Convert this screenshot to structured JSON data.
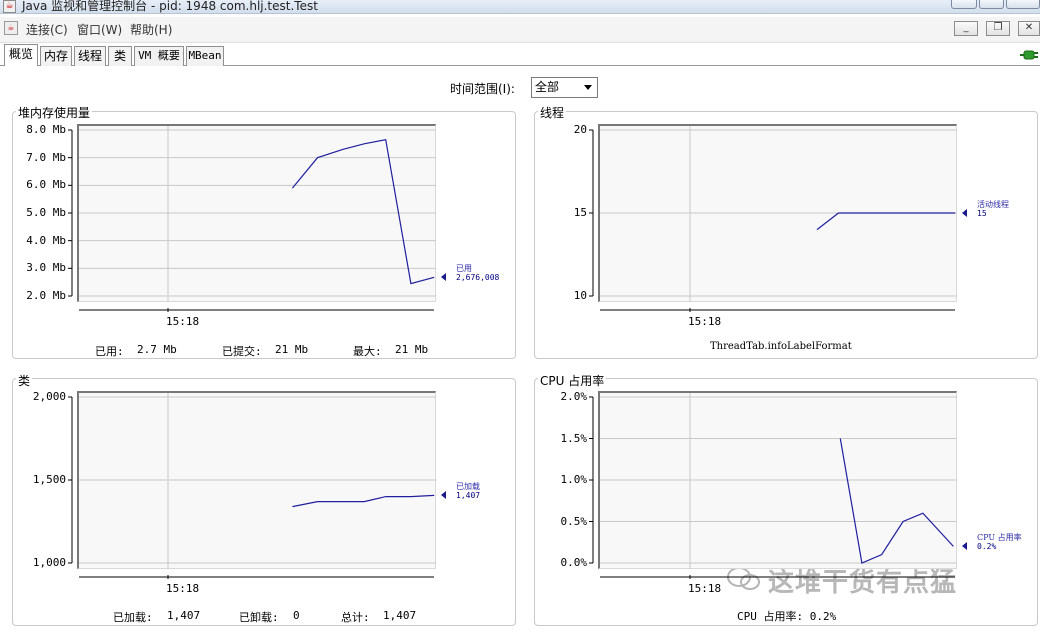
{
  "window": {
    "title": "Java 监视和管理控制台 - pid: 1948 com.hlj.test.Test",
    "app_icon": "java-cup-icon"
  },
  "menu": {
    "items": [
      "连接(C)",
      "窗口(W)",
      "帮助(H)"
    ]
  },
  "tabs": [
    "概览",
    "内存",
    "线程",
    "类",
    "VM 概要",
    "MBean"
  ],
  "active_tab": "概览",
  "time_range": {
    "label": "时间范围(I):",
    "value": "全部"
  },
  "colors": {
    "series_line": "#1f1fa0",
    "legend_text": "#2b2ba8",
    "grid": "#c8c8c8"
  },
  "panels": {
    "heap": {
      "title": "堆内存使用量",
      "y_ticks": [
        "8.0 Mb",
        "7.0 Mb",
        "6.0 Mb",
        "5.0 Mb",
        "4.0 Mb",
        "3.0 Mb",
        "2.0 Mb"
      ],
      "x_tick": "15:18",
      "legend_name": "已用",
      "legend_value": "2,676,008",
      "footer": {
        "used_label": "已用:",
        "used_value": "2.7  Mb",
        "committed_label": "已提交:",
        "committed_value": "21  Mb",
        "max_label": "最大:",
        "max_value": "21  Mb"
      }
    },
    "threads": {
      "title": "线程",
      "y_ticks": [
        "20",
        "15",
        "10"
      ],
      "x_tick": "15:18",
      "legend_name": "活动线程",
      "legend_value": "15",
      "footer": "ThreadTab.infoLabelFormat"
    },
    "classes": {
      "title": "类",
      "y_ticks": [
        "2,000",
        "1,500",
        "1,000"
      ],
      "x_tick": "15:18",
      "legend_name": "已加载",
      "legend_value": "1,407",
      "footer": {
        "loaded_label": "已加载:",
        "loaded_value": "1,407",
        "unloaded_label": "已卸载:",
        "unloaded_value": "0",
        "total_label": "总计:",
        "total_value": "1,407"
      }
    },
    "cpu": {
      "title": "CPU 占用率",
      "y_ticks": [
        "2.0%",
        "1.5%",
        "1.0%",
        "0.5%",
        "0.0%"
      ],
      "x_tick": "15:18",
      "legend_name": "CPU 占用率",
      "legend_value": "0.2%",
      "footer": "CPU 占用率: 0.2%"
    }
  },
  "chart_data": [
    {
      "type": "line",
      "title": "堆内存使用量",
      "series": [
        {
          "name": "已用",
          "unit": "Mb",
          "values": [
            5.9,
            7.0,
            7.3,
            7.5,
            7.65,
            2.45,
            2.676
          ]
        }
      ],
      "ylim": [
        2.0,
        8.0
      ]
    },
    {
      "type": "line",
      "title": "线程",
      "series": [
        {
          "name": "活动线程",
          "values": [
            14,
            15,
            15,
            15,
            15,
            15,
            15
          ]
        }
      ],
      "ylim": [
        10,
        20
      ]
    },
    {
      "type": "line",
      "title": "类",
      "series": [
        {
          "name": "已加载",
          "values": [
            1340,
            1370,
            1370,
            1370,
            1400,
            1400,
            1407
          ]
        }
      ],
      "ylim": [
        1000,
        2000
      ]
    },
    {
      "type": "line",
      "title": "CPU 占用率",
      "series": [
        {
          "name": "CPU 占用率",
          "unit": "%",
          "values": [
            1.5,
            0.0,
            0.1,
            0.5,
            0.6,
            0.2
          ]
        }
      ],
      "ylim": [
        0.0,
        2.0
      ]
    }
  ],
  "watermark": "这堆干货有点猛"
}
